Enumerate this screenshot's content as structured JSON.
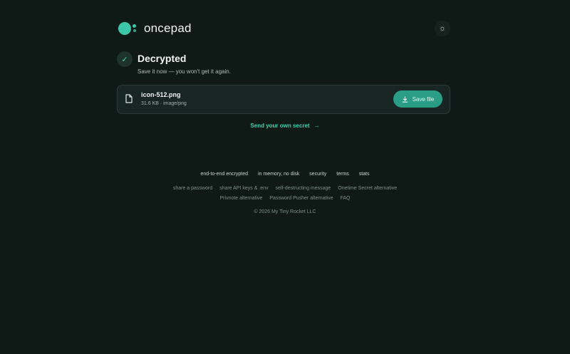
{
  "brand": {
    "name": "oncepad",
    "accent": "#3cc7a8"
  },
  "header": {
    "theme_toggle_icon": "sun-icon"
  },
  "status": {
    "title": "Decrypted",
    "subtitle": "Save it now — you won't get it again.",
    "icon": "check-icon"
  },
  "file": {
    "name": "icon-512.png",
    "meta": "31.6 KB · image/png",
    "save_label": "Save file"
  },
  "send_link": {
    "label": "Send your own secret"
  },
  "footer": {
    "row1": [
      "end-to-end encrypted",
      "in memory, no disk",
      "security",
      "terms",
      "stats"
    ],
    "row2": [
      "share a password",
      "share API keys & .env",
      "self-destructing message",
      "Onetime Secret alternative"
    ],
    "row3": [
      "Privnote alternative",
      "Password Pusher alternative",
      "FAQ"
    ],
    "copyright": "© 2026 My Tiny Rocket LLC"
  }
}
